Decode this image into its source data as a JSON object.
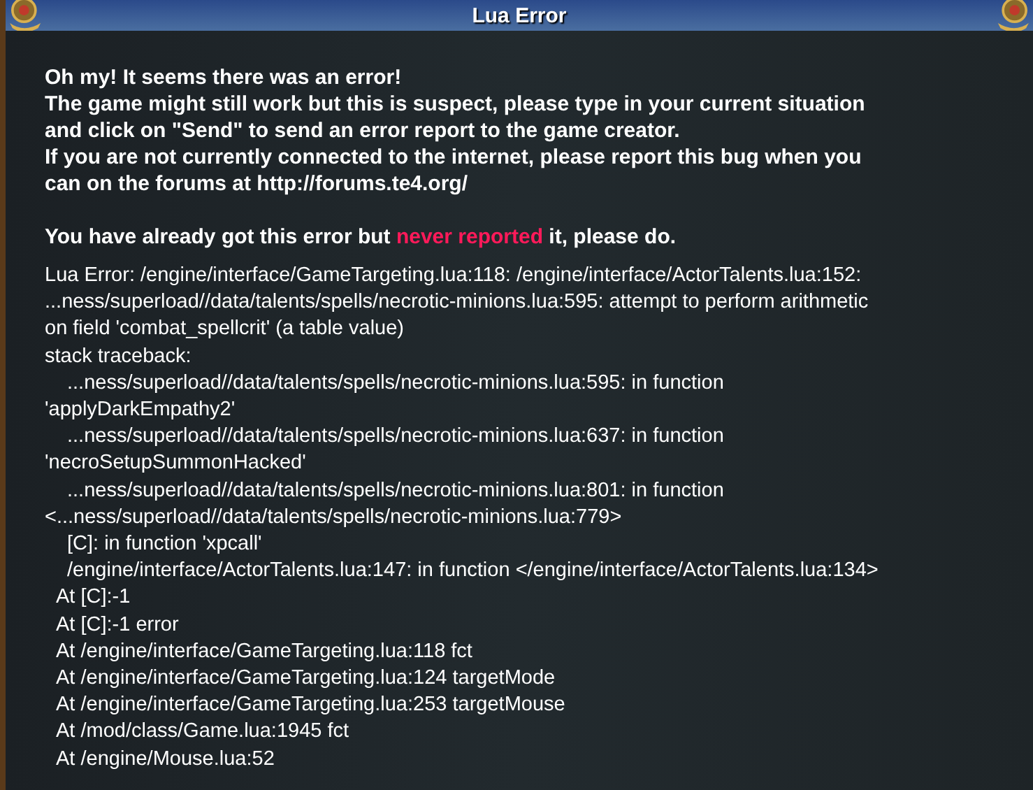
{
  "window": {
    "title": "Lua Error"
  },
  "intro_lines": [
    "Oh my! It seems there was an error!",
    "The game might still work but this is suspect, please type in your current situation",
    "and click on \"Send\" to send an error report to the game creator.",
    "If you are not currently connected to the internet, please report this bug when you",
    "can on the forums at http://forums.te4.org/"
  ],
  "notice": {
    "before": "You have already got this error but ",
    "highlight": "never reported",
    "after": " it, please do."
  },
  "trace_lines": [
    {
      "kind": "message",
      "text": "Lua Error: /engine/interface/GameTargeting.lua:118: /engine/interface/ActorTalents.lua:152:"
    },
    {
      "kind": "message",
      "text": "...ness/superload//data/talents/spells/necrotic-minions.lua:595: attempt to perform arithmetic"
    },
    {
      "kind": "message",
      "text": "on field 'combat_spellcrit' (a table value)"
    },
    {
      "kind": "message",
      "text": "stack traceback:"
    },
    {
      "kind": "frame",
      "text": "...ness/superload//data/talents/spells/necrotic-minions.lua:595: in function"
    },
    {
      "kind": "message",
      "text": "'applyDarkEmpathy2'"
    },
    {
      "kind": "frame",
      "text": "...ness/superload//data/talents/spells/necrotic-minions.lua:637: in function"
    },
    {
      "kind": "message",
      "text": "'necroSetupSummonHacked'"
    },
    {
      "kind": "frame",
      "text": "...ness/superload//data/talents/spells/necrotic-minions.lua:801: in function"
    },
    {
      "kind": "message",
      "text": "<...ness/superload//data/talents/spells/necrotic-minions.lua:779>"
    },
    {
      "kind": "frame",
      "text": "[C]: in function 'xpcall'"
    },
    {
      "kind": "frame",
      "text": "/engine/interface/ActorTalents.lua:147: in function </engine/interface/ActorTalents.lua:134>"
    },
    {
      "kind": "at",
      "text": "At [C]:-1"
    },
    {
      "kind": "at",
      "text": "At [C]:-1 error"
    },
    {
      "kind": "at",
      "text": "At /engine/interface/GameTargeting.lua:118 fct"
    },
    {
      "kind": "at",
      "text": "At /engine/interface/GameTargeting.lua:124 targetMode"
    },
    {
      "kind": "at",
      "text": "At /engine/interface/GameTargeting.lua:253 targetMouse"
    },
    {
      "kind": "at",
      "text": "At /mod/class/Game.lua:1945 fct"
    },
    {
      "kind": "at",
      "text": "At /engine/Mouse.lua:52"
    }
  ]
}
